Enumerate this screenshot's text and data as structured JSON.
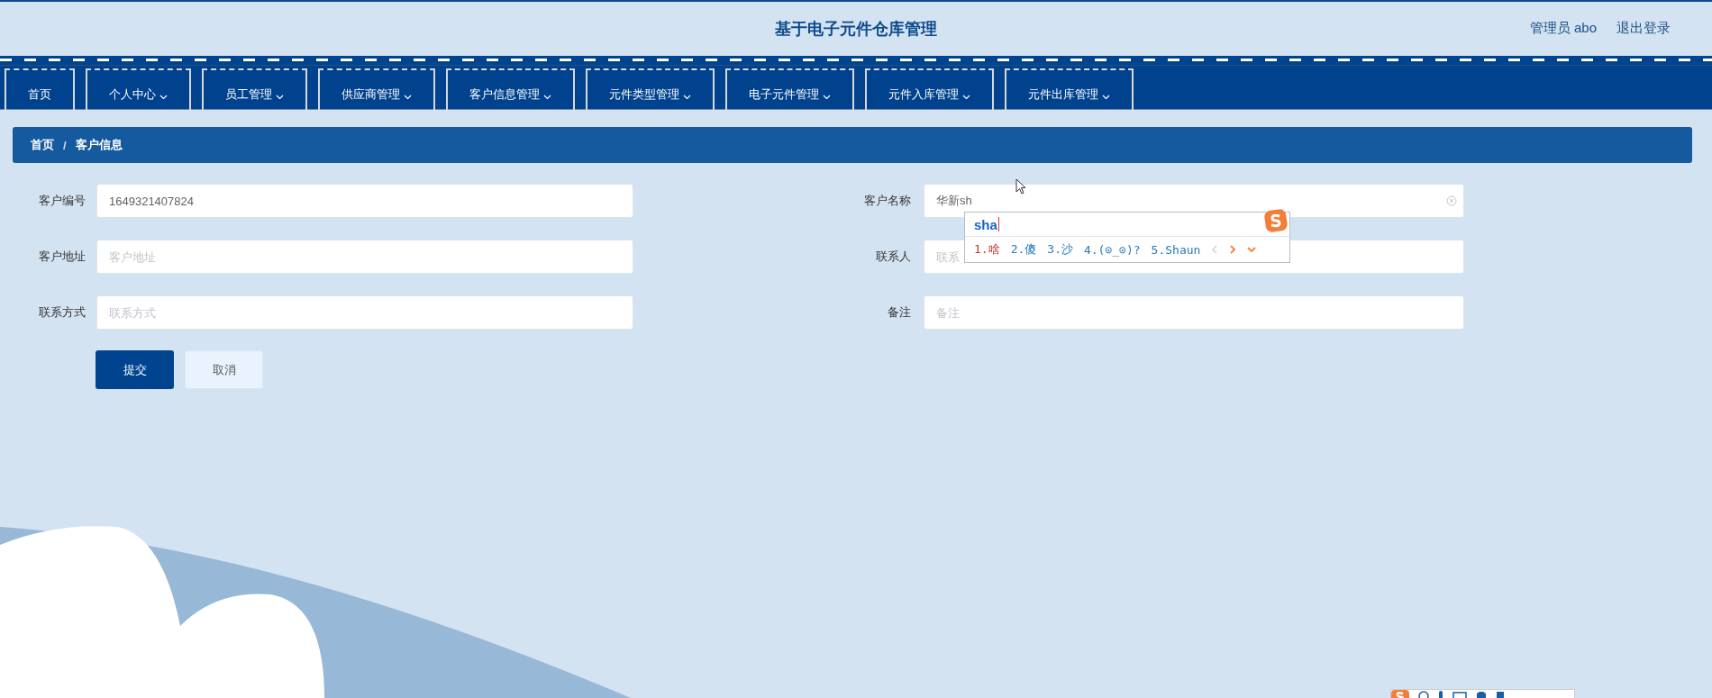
{
  "header": {
    "title": "基于电子元件仓库管理",
    "user": "管理员 abo",
    "logout": "退出登录"
  },
  "nav": [
    {
      "label": "首页",
      "dropdown": false
    },
    {
      "label": "个人中心",
      "dropdown": true
    },
    {
      "label": "员工管理",
      "dropdown": true
    },
    {
      "label": "供应商管理",
      "dropdown": true
    },
    {
      "label": "客户信息管理",
      "dropdown": true
    },
    {
      "label": "元件类型管理",
      "dropdown": true
    },
    {
      "label": "电子元件管理",
      "dropdown": true
    },
    {
      "label": "元件入库管理",
      "dropdown": true
    },
    {
      "label": "元件出库管理",
      "dropdown": true
    }
  ],
  "breadcrumb": [
    "首页",
    "客户信息"
  ],
  "breadcrumb_separator": "/",
  "form": {
    "rows": [
      [
        {
          "label": "客户编号",
          "value": "1649321407824"
        },
        {
          "label": "客户名称",
          "value": "华新sh",
          "clearable": true
        }
      ],
      [
        {
          "label": "客户地址",
          "placeholder": "客户地址"
        },
        {
          "label": "联系人",
          "placeholder": "联系"
        }
      ],
      [
        {
          "label": "联系方式",
          "placeholder": "联系方式"
        },
        {
          "label": "备注",
          "placeholder": "备注"
        }
      ]
    ],
    "buttons": [
      {
        "label": "提交",
        "kind": "primary"
      },
      {
        "label": "取消",
        "kind": "plain"
      }
    ]
  },
  "ime": {
    "composition": "sha",
    "candidates": [
      {
        "label": "1.啥",
        "selected": true
      },
      {
        "label": "2.傻",
        "selected": false
      },
      {
        "label": "3.沙",
        "selected": false
      },
      {
        "label": "4.(⊙_⊙)?",
        "selected": false
      },
      {
        "label": "5.Shaun",
        "selected": false
      }
    ]
  }
}
